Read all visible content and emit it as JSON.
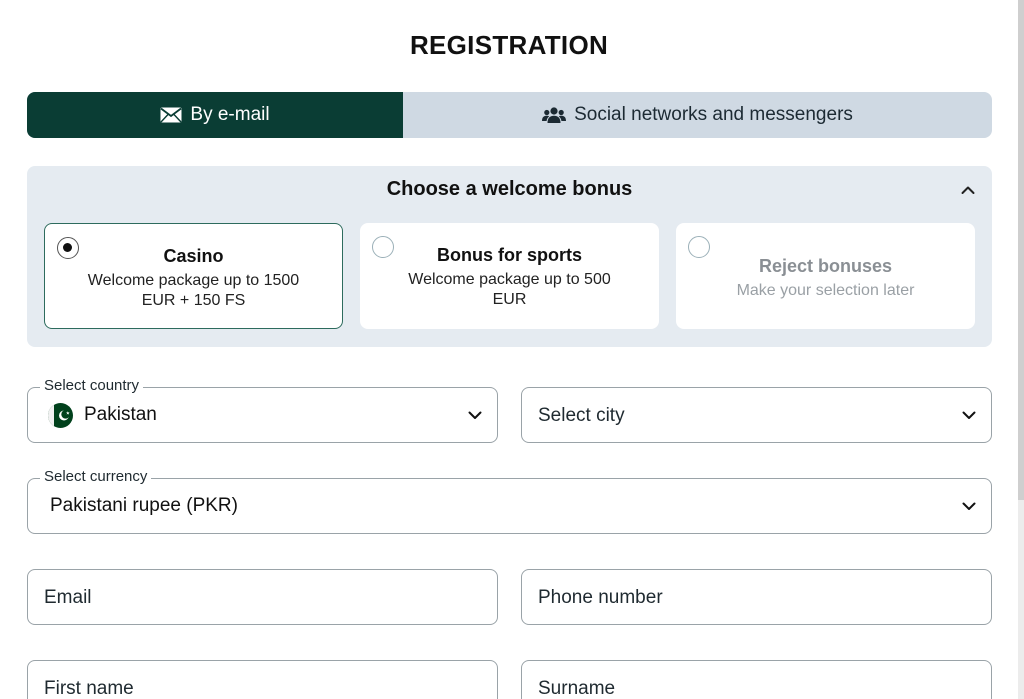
{
  "dialog": {
    "title": "REGISTRATION"
  },
  "tabs": [
    {
      "label": "By e-mail",
      "icon": "envelope-icon",
      "active": true
    },
    {
      "label": "Social networks and messengers",
      "icon": "users-icon",
      "active": false
    }
  ],
  "bonus": {
    "heading": "Choose a welcome bonus",
    "options": [
      {
        "title": "Casino",
        "description": "Welcome package up to 1500 EUR + 150 FS",
        "selected": true
      },
      {
        "title": "Bonus for sports",
        "description": "Welcome package up to 500 EUR",
        "selected": false
      },
      {
        "title": "Reject bonuses",
        "description": "Make your selection later",
        "selected": false
      }
    ]
  },
  "form": {
    "country": {
      "label": "Select country",
      "value": "Pakistan"
    },
    "city": {
      "placeholder": "Select city"
    },
    "currency": {
      "label": "Select currency",
      "value": "Pakistani rupee (PKR)"
    },
    "email": {
      "placeholder": "Email"
    },
    "phone": {
      "placeholder": "Phone number"
    },
    "first_name": {
      "placeholder": "First name"
    },
    "surname": {
      "placeholder": "Surname"
    }
  },
  "colors": {
    "accent": "#0a3d34",
    "tab_inactive_bg": "#cfd9e3",
    "panel_bg": "#e5ebf1",
    "border": "#9aa3a8"
  }
}
